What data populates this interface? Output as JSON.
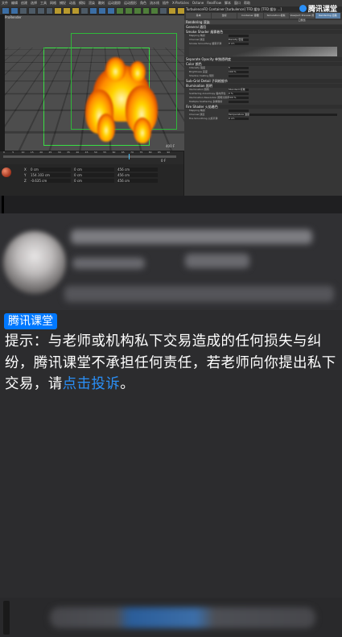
{
  "app": {
    "menu_items": [
      "文件",
      "编辑",
      "创建",
      "选择",
      "工具",
      "网格",
      "捕捉",
      "动画",
      "模拟",
      "渲染",
      "雕刻",
      "运动跟踪",
      "运动图形",
      "角色",
      "流水线",
      "插件",
      "X-Particles",
      "Octane",
      "RealFlow",
      "脚本",
      "窗口",
      "帮助"
    ],
    "viewport_label": "ProRender",
    "timeline_ticks": [
      "0",
      "5",
      "10",
      "15",
      "20",
      "25",
      "30",
      "35",
      "40",
      "45",
      "50",
      "55",
      "60",
      "65",
      "70",
      "75",
      "80",
      "85",
      "90"
    ],
    "frame_readout": "400 F",
    "fps_readout": "0 F",
    "coords": [
      {
        "label": "X",
        "a": "0 cm",
        "b": "0 cm",
        "c": "456 cm"
      },
      {
        "label": "Y",
        "a": "154.103 cm",
        "b": "0 cm",
        "c": "456 cm"
      },
      {
        "label": "Z",
        "a": "-0.635 cm",
        "b": "0 cm",
        "c": "456 cm"
      }
    ]
  },
  "panel": {
    "title": "TurbulenceFD Container [turbulence] TFD 缓存 [TFD 缓存 ...]",
    "tabs": [
      "基本",
      "坐标",
      "Container 容器",
      "Simulation 模拟",
      "Viewport Preview 视口预览",
      "Rendering 渲染"
    ],
    "active_tab": "Rendering 渲染",
    "heading": "Rendering 渲染",
    "sections": [
      {
        "title": "General 通用",
        "rows": []
      },
      {
        "title": "Smoke Shader 烟雾着色",
        "rows": [
          {
            "label": "Mapping 映射",
            "value": ""
          },
          {
            "label": "Channel 通道",
            "value": "Density 密度"
          },
          {
            "label": "Smoke Smoothing 烟雾平滑",
            "value": "0 cm"
          }
        ]
      },
      {
        "title": "Separate Opacity 单独透明度",
        "rows": []
      },
      {
        "title": "Color 颜色",
        "rows": [
          {
            "label": "Intensity 强度",
            "value": "5"
          },
          {
            "label": "Brightness 亮度",
            "value": "100 %"
          },
          {
            "label": "Shadow Casting 阴影",
            "value": ""
          }
        ]
      },
      {
        "title": "Sub-Grid Detail 子网格细节",
        "rows": []
      },
      {
        "title": "Illumination 照明",
        "rows": [
          {
            "label": "Illumination 照明",
            "value": "Standard 标准"
          },
          {
            "label": "Scattering Anisotropy 各向异性",
            "value": "0 %"
          },
          {
            "label": "Illumination Resolution 照明分辨率",
            "value": "100 %"
          },
          {
            "label": "Multiple Scattering 多重散射",
            "value": ""
          }
        ]
      },
      {
        "title": "Fire Shader 火焰着色",
        "rows": [
          {
            "label": "Mapping 映射",
            "value": ""
          },
          {
            "label": "Channel 通道",
            "value": "Temperature 温度"
          },
          {
            "label": "Fire Smoothing 火焰平滑",
            "value": "0 cm"
          }
        ]
      }
    ]
  },
  "watermark": {
    "text": "腾讯课堂"
  },
  "notice": {
    "badge": "腾讯课堂",
    "text": "提示：与老师或机构私下交易造成的任何损失与纠纷，腾讯课堂不承担任何责任，若老师向你提出私下交易，请",
    "link": "点击投诉",
    "end": "。"
  }
}
